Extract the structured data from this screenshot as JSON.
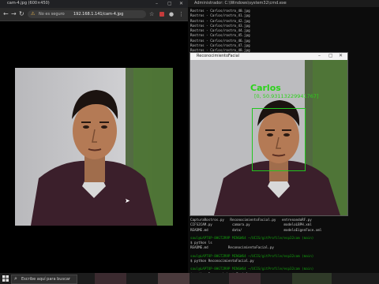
{
  "browser": {
    "window_title": "cam-4.jpg (600×450)",
    "insecure_label": "No es seguro",
    "url": "192.168.1.141/cam-4.jpg"
  },
  "terminal": {
    "window_title": "Administrador: C:\\Windows\\system32\\cmd.exe",
    "log_lines": [
      "Rostros - Carlos/rostro_40.jpg",
      "Rostros - Carlos/rostro_41.jpg",
      "Rostros - Carlos/rostro_42.jpg",
      "Rostros - Carlos/rostro_43.jpg",
      "Rostros - Carlos/rostro_44.jpg",
      "Rostros - Carlos/rostro_45.jpg",
      "Rostros - Carlos/rostro_46.jpg",
      "Rostros - Carlos/rostro_47.jpg",
      "Rostros - Carlos/rostro_48.jpg",
      "Rostros - Carlos/rostro_49.jpg"
    ],
    "listing_row_1": "CapturaRostros.py   ReconocimientoFacial.py   entrenandoRF.py",
    "listing_row_2": "CIFS2CAM.py          camara.py                 modeloLBPH.xml",
    "listing_row_3": "README.md            data/                     modeloEigenFace.xml",
    "prompt_1": "saul@LAPTOP-8HGT2R9P MINGW64 ~/UCIS/gitProfile/esp32cam (main)",
    "cmd_1": "$ python ls",
    "out_1": "README.md          ReconocimientoFacial.py",
    "prompt_2": "saul@LAPTOP-8HGT2R9P MINGW64 ~/UCIS/gitProfile/esp32cam (main)",
    "cmd_2": "$ python ReconocimientoFacial.py",
    "prompt_3": "saul@LAPTOP-8HGT2R9P MINGW64 ~/UCIS/gitProfile/esp32cam (main)",
    "cmd_3": "$ python ReconocimientoFacial.py"
  },
  "popup": {
    "window_title": "ReconocimientoFacial",
    "detected_name": "Carlos",
    "confidence_text": "[0, 50.93113229941767]"
  },
  "taskbar": {
    "search_placeholder": "Escribe aquí para buscar"
  },
  "colors": {
    "detection_box": "#22c61f",
    "terminal_prompt_green": "#13a10e",
    "terminal_path_blue": "#3b78ff"
  }
}
